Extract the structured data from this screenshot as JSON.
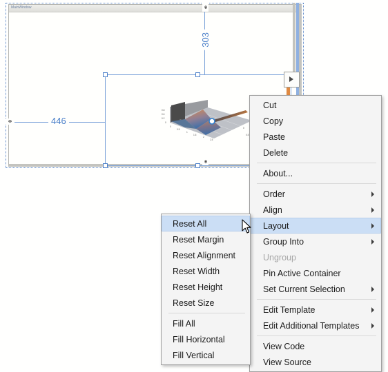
{
  "designer": {
    "window_title": "MainWindow",
    "measurements": {
      "horizontal": "446",
      "vertical": "303",
      "link_icon": "chain-link-icon"
    },
    "adorner": {
      "glyph": "play-triangle-icon"
    }
  },
  "chart_data": {
    "type": "surface",
    "title": "",
    "xlabel": "",
    "ylabel": "",
    "zlabel": "",
    "z_ticks": [
      "0.8",
      "0.6",
      "0.2",
      "0"
    ],
    "x_ticks": [
      "0",
      "0.5",
      "1",
      "1.5",
      "2",
      "2.5"
    ],
    "y_ticks": [
      "0",
      "0.5"
    ],
    "colors": {
      "high": "#d98a4e",
      "low": "#3f6fa8",
      "floor": "#b9bcc2",
      "wall": "#5a5a5a"
    },
    "marker": {
      "label": "",
      "color": "#ffffff",
      "ring": "#2f7fd0"
    },
    "grid": true,
    "legend": "none"
  },
  "context_menu": {
    "items": [
      {
        "label": "Cut",
        "type": "item",
        "submenu": false,
        "enabled": true,
        "highlight": false
      },
      {
        "label": "Copy",
        "type": "item",
        "submenu": false,
        "enabled": true,
        "highlight": false
      },
      {
        "label": "Paste",
        "type": "item",
        "submenu": false,
        "enabled": true,
        "highlight": false
      },
      {
        "label": "Delete",
        "type": "item",
        "submenu": false,
        "enabled": true,
        "highlight": false
      },
      {
        "label": "",
        "type": "separator"
      },
      {
        "label": "About...",
        "type": "item",
        "submenu": false,
        "enabled": true,
        "highlight": false
      },
      {
        "label": "",
        "type": "separator"
      },
      {
        "label": "Order",
        "type": "item",
        "submenu": true,
        "enabled": true,
        "highlight": false
      },
      {
        "label": "Align",
        "type": "item",
        "submenu": true,
        "enabled": true,
        "highlight": false
      },
      {
        "label": "Layout",
        "type": "item",
        "submenu": true,
        "enabled": true,
        "highlight": true
      },
      {
        "label": "Group Into",
        "type": "item",
        "submenu": true,
        "enabled": true,
        "highlight": false
      },
      {
        "label": "Ungroup",
        "type": "item",
        "submenu": false,
        "enabled": false,
        "highlight": false
      },
      {
        "label": "Pin Active Container",
        "type": "item",
        "submenu": false,
        "enabled": true,
        "highlight": false
      },
      {
        "label": "Set Current Selection",
        "type": "item",
        "submenu": true,
        "enabled": true,
        "highlight": false
      },
      {
        "label": "",
        "type": "separator"
      },
      {
        "label": "Edit Template",
        "type": "item",
        "submenu": true,
        "enabled": true,
        "highlight": false
      },
      {
        "label": "Edit Additional Templates",
        "type": "item",
        "submenu": true,
        "enabled": true,
        "highlight": false
      },
      {
        "label": "",
        "type": "separator"
      },
      {
        "label": "View Code",
        "type": "item",
        "submenu": false,
        "enabled": true,
        "highlight": false
      },
      {
        "label": "View Source",
        "type": "item",
        "submenu": false,
        "enabled": true,
        "highlight": false
      }
    ]
  },
  "layout_submenu": {
    "items": [
      {
        "label": "Reset All",
        "type": "item",
        "highlight": true
      },
      {
        "label": "Reset Margin",
        "type": "item",
        "highlight": false
      },
      {
        "label": "Reset Alignment",
        "type": "item",
        "highlight": false
      },
      {
        "label": "Reset Width",
        "type": "item",
        "highlight": false
      },
      {
        "label": "Reset Height",
        "type": "item",
        "highlight": false
      },
      {
        "label": "Reset Size",
        "type": "item",
        "highlight": false
      },
      {
        "label": "",
        "type": "separator"
      },
      {
        "label": "Fill All",
        "type": "item",
        "highlight": false
      },
      {
        "label": "Fill Horizontal",
        "type": "item",
        "highlight": false
      },
      {
        "label": "Fill Vertical",
        "type": "item",
        "highlight": false
      }
    ]
  },
  "colors": {
    "menu_background": "#f4f4f4",
    "menu_border": "#a0a0a0",
    "highlight": "#cbdef5",
    "highlight_border": "#b4cdec",
    "selection_blue": "#7ba2d9",
    "measure_text": "#4a7fc9",
    "disabled_text": "#a6a6a6"
  }
}
